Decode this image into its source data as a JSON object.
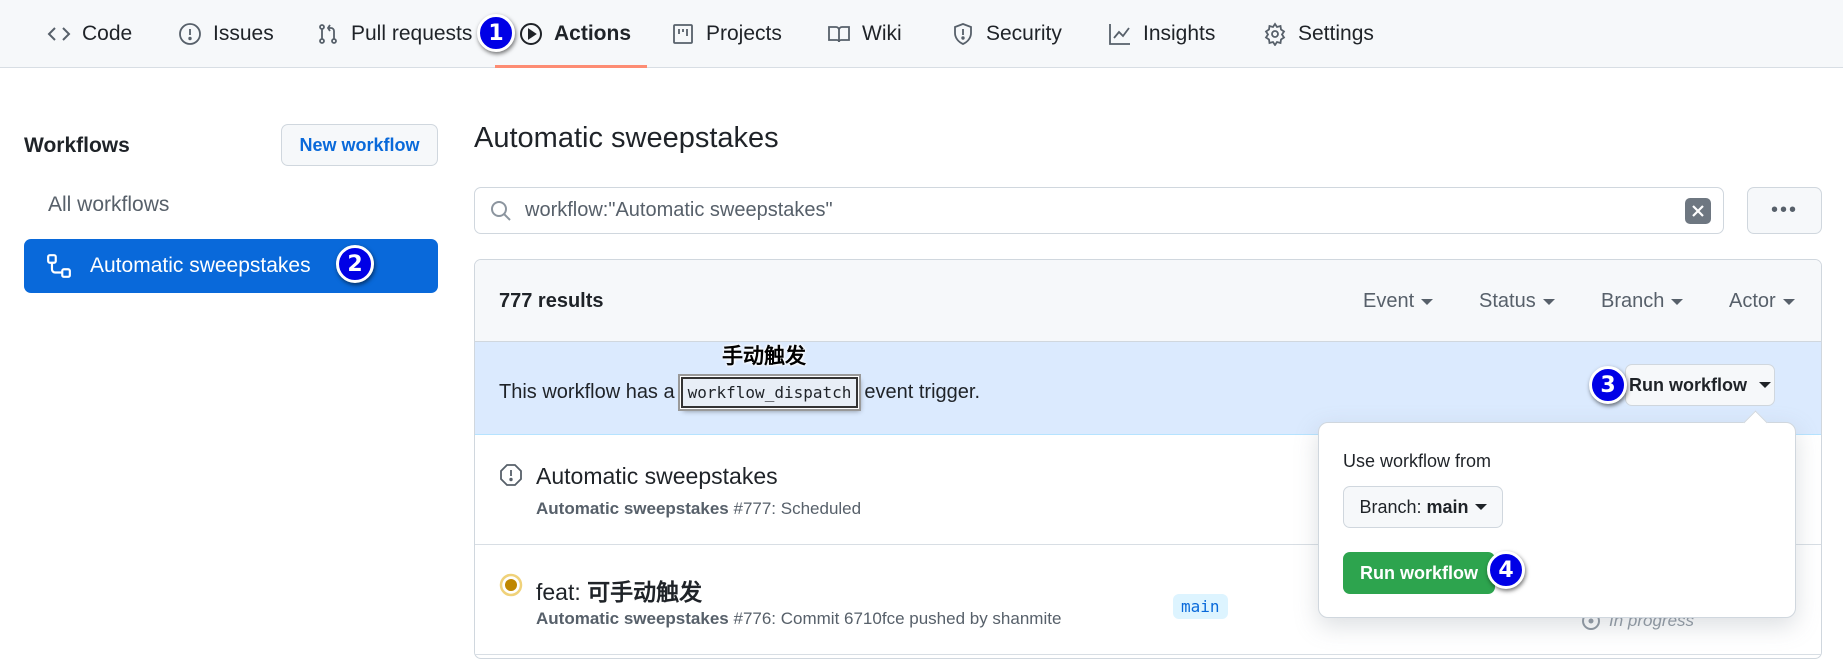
{
  "nav": {
    "tabs": [
      {
        "label": "Code",
        "icon": "code-icon"
      },
      {
        "label": "Issues",
        "icon": "issue-icon"
      },
      {
        "label": "Pull requests",
        "icon": "pull-request-icon"
      },
      {
        "label": "Actions",
        "icon": "play-icon",
        "active": true
      },
      {
        "label": "Projects",
        "icon": "project-icon"
      },
      {
        "label": "Wiki",
        "icon": "book-icon"
      },
      {
        "label": "Security",
        "icon": "shield-icon"
      },
      {
        "label": "Insights",
        "icon": "graph-icon"
      },
      {
        "label": "Settings",
        "icon": "gear-icon"
      }
    ],
    "active_underline_color": "#fd8c73"
  },
  "annotations": {
    "step1": "1",
    "step2": "2",
    "step3": "3",
    "step4": "4",
    "dispatch_label": "手动触发",
    "badge_color": "#0000e6"
  },
  "sidebar": {
    "title": "Workflows",
    "new_workflow_label": "New workflow",
    "items": [
      {
        "label": "All workflows"
      },
      {
        "label": "Automatic sweepstakes",
        "active": true,
        "icon": "workflow-icon"
      }
    ],
    "active_color": "#0969da"
  },
  "main": {
    "title": "Automatic sweepstakes",
    "search": {
      "value": "workflow:\"Automatic sweepstakes\""
    },
    "more_label": "•••",
    "results_count": "777 results",
    "filters": [
      "Event",
      "Status",
      "Branch",
      "Actor"
    ],
    "dispatch": {
      "prefix": "This workflow has a",
      "code": "workflow_dispatch",
      "suffix": "event trigger.",
      "run_button_label": "Run workflow"
    },
    "runs": [
      {
        "title": "Automatic sweepstakes",
        "workflow": "Automatic sweepstakes",
        "detail": "#777: Scheduled",
        "status_icon": "alert-octagon-icon"
      },
      {
        "title_prefix": "feat: ",
        "title_cn": "可手动触发",
        "workflow": "Automatic sweepstakes",
        "detail": "#776: Commit 6710fce pushed by shanmite",
        "branch": "main",
        "status": "In progress",
        "status_icon": "in-progress-icon",
        "status_color": "#bf8700"
      }
    ]
  },
  "popover": {
    "label": "Use workflow from",
    "branch_prefix": "Branch:",
    "branch_value": "main",
    "run_label": "Run workflow",
    "run_color": "#2da44e"
  }
}
